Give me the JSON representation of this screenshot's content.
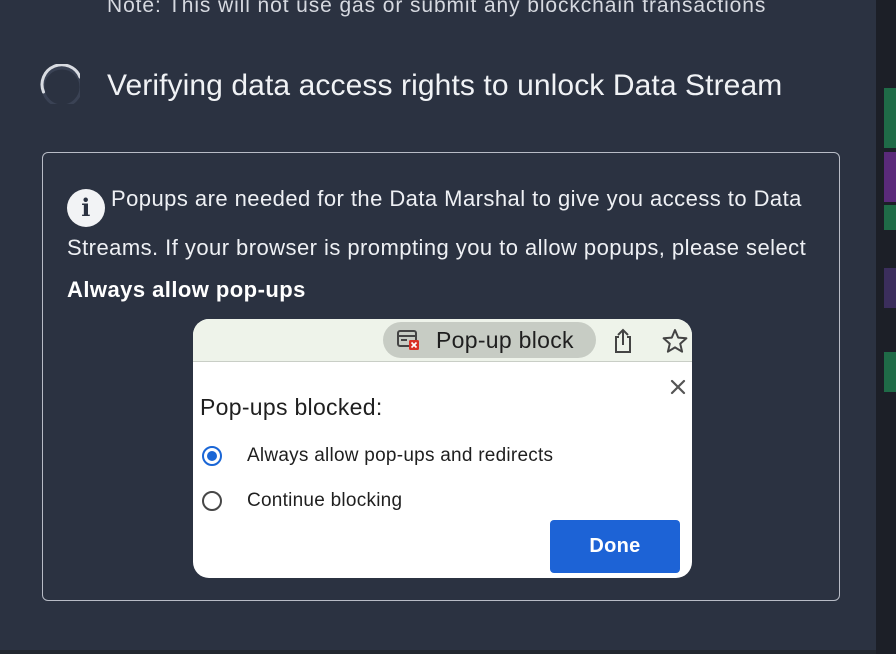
{
  "modal": {
    "note": "Note: This will not use gas or submit any blockchain transactions",
    "status_text": "Verifying data access rights to unlock Data Stream",
    "spinner_icon": "loading-spinner-icon",
    "info": {
      "icon": "info-icon",
      "icon_glyph": "i",
      "text": "Popups are needed for the Data Marshal to give you access to Data Streams. If your browser is prompting you to allow popups, please select ",
      "bold_text": "Always allow pop-ups"
    }
  },
  "popup_illustration": {
    "chip_label": "Pop-up block",
    "chip_icon": "popup-blocked-icon",
    "title": "Pop-ups blocked:",
    "options": [
      {
        "label": "Always allow pop-ups and redirects",
        "selected": true
      },
      {
        "label": "Continue blocking",
        "selected": false
      }
    ],
    "done_label": "Done",
    "icons": [
      "share-icon",
      "star-icon",
      "close-icon"
    ]
  },
  "colors": {
    "modal_bg": "#2b3241",
    "accent_blue": "#1d63d6",
    "radio_selected": "#1a66d6",
    "toolbar_bg": "#eef3ea"
  }
}
